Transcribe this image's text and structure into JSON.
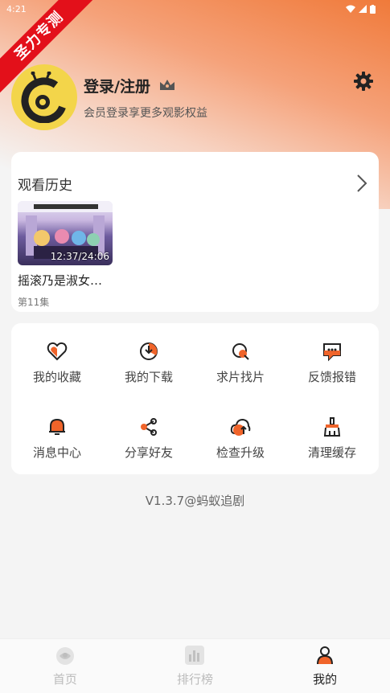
{
  "status_bar": {
    "time": "4:21"
  },
  "ribbon": {
    "text": "圣力专测"
  },
  "profile": {
    "login_label": "登录/注册",
    "subtitle": "会员登录享更多观影权益"
  },
  "history": {
    "title": "观看历史",
    "items": [
      {
        "name": "摇滚乃是淑女…",
        "progress": "12:37/24:06",
        "episode": "第11集"
      }
    ]
  },
  "grid": {
    "items": [
      {
        "label": "我的收藏",
        "icon": "heart-icon"
      },
      {
        "label": "我的下载",
        "icon": "download-icon"
      },
      {
        "label": "求片找片",
        "icon": "search-film-icon"
      },
      {
        "label": "反馈报错",
        "icon": "feedback-icon"
      },
      {
        "label": "消息中心",
        "icon": "bell-icon"
      },
      {
        "label": "分享好友",
        "icon": "share-icon"
      },
      {
        "label": "检查升级",
        "icon": "upgrade-icon"
      },
      {
        "label": "清理缓存",
        "icon": "broom-icon"
      }
    ]
  },
  "version": "V1.3.7@蚂蚁追剧",
  "tabs": [
    {
      "label": "首页",
      "icon": "home-icon",
      "active": false
    },
    {
      "label": "排行榜",
      "icon": "ranking-icon",
      "active": false
    },
    {
      "label": "我的",
      "icon": "profile-icon",
      "active": true
    }
  ],
  "colors": {
    "accent": "#f0642a",
    "avatar_bg": "#f3d54a",
    "ribbon": "#e3101a"
  }
}
